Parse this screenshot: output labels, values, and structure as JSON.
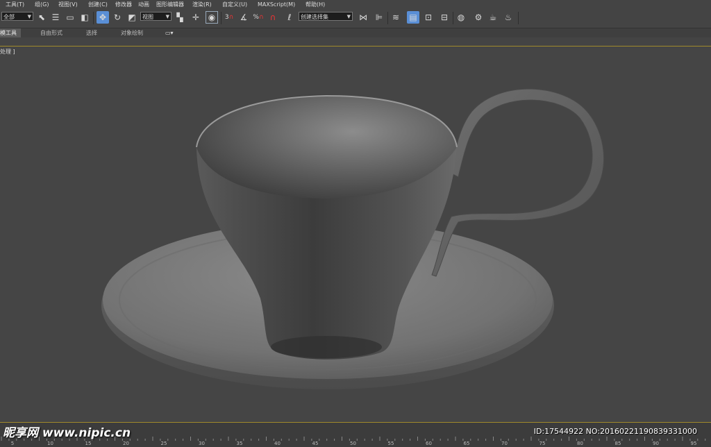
{
  "menu": [
    "工具(T)",
    "组(G)",
    "视图(V)",
    "创建(C)",
    "修改器",
    "动画",
    "图形编辑器",
    "渲染(R)",
    "自定义(U)",
    "MAXScript(M)",
    "帮助(H)"
  ],
  "toolbar": {
    "selection_filter": "全部",
    "reference_coord": "视图",
    "named_selection": "创建选择集",
    "snap_angle_label": "3",
    "percent_label": "%"
  },
  "ribbon": {
    "tabs": [
      "建模工具",
      "自由形式",
      "选择",
      "对象绘制"
    ],
    "active_tab_display": "模工具"
  },
  "viewport": {
    "label": "处理 ]",
    "colors": {
      "background": "#454545",
      "object": "#7a7a7a",
      "accent_line": "#a08a2a"
    }
  },
  "timeline": {
    "ticks": [
      "5",
      "10",
      "15",
      "20",
      "25",
      "30",
      "35",
      "40",
      "45",
      "50",
      "55",
      "60",
      "65",
      "70",
      "75",
      "80",
      "85",
      "90",
      "95"
    ]
  },
  "watermark": {
    "logo_text": "昵享网 www.nipic.cn",
    "id_text": "ID:17544922 NO:20160221190839331000"
  }
}
